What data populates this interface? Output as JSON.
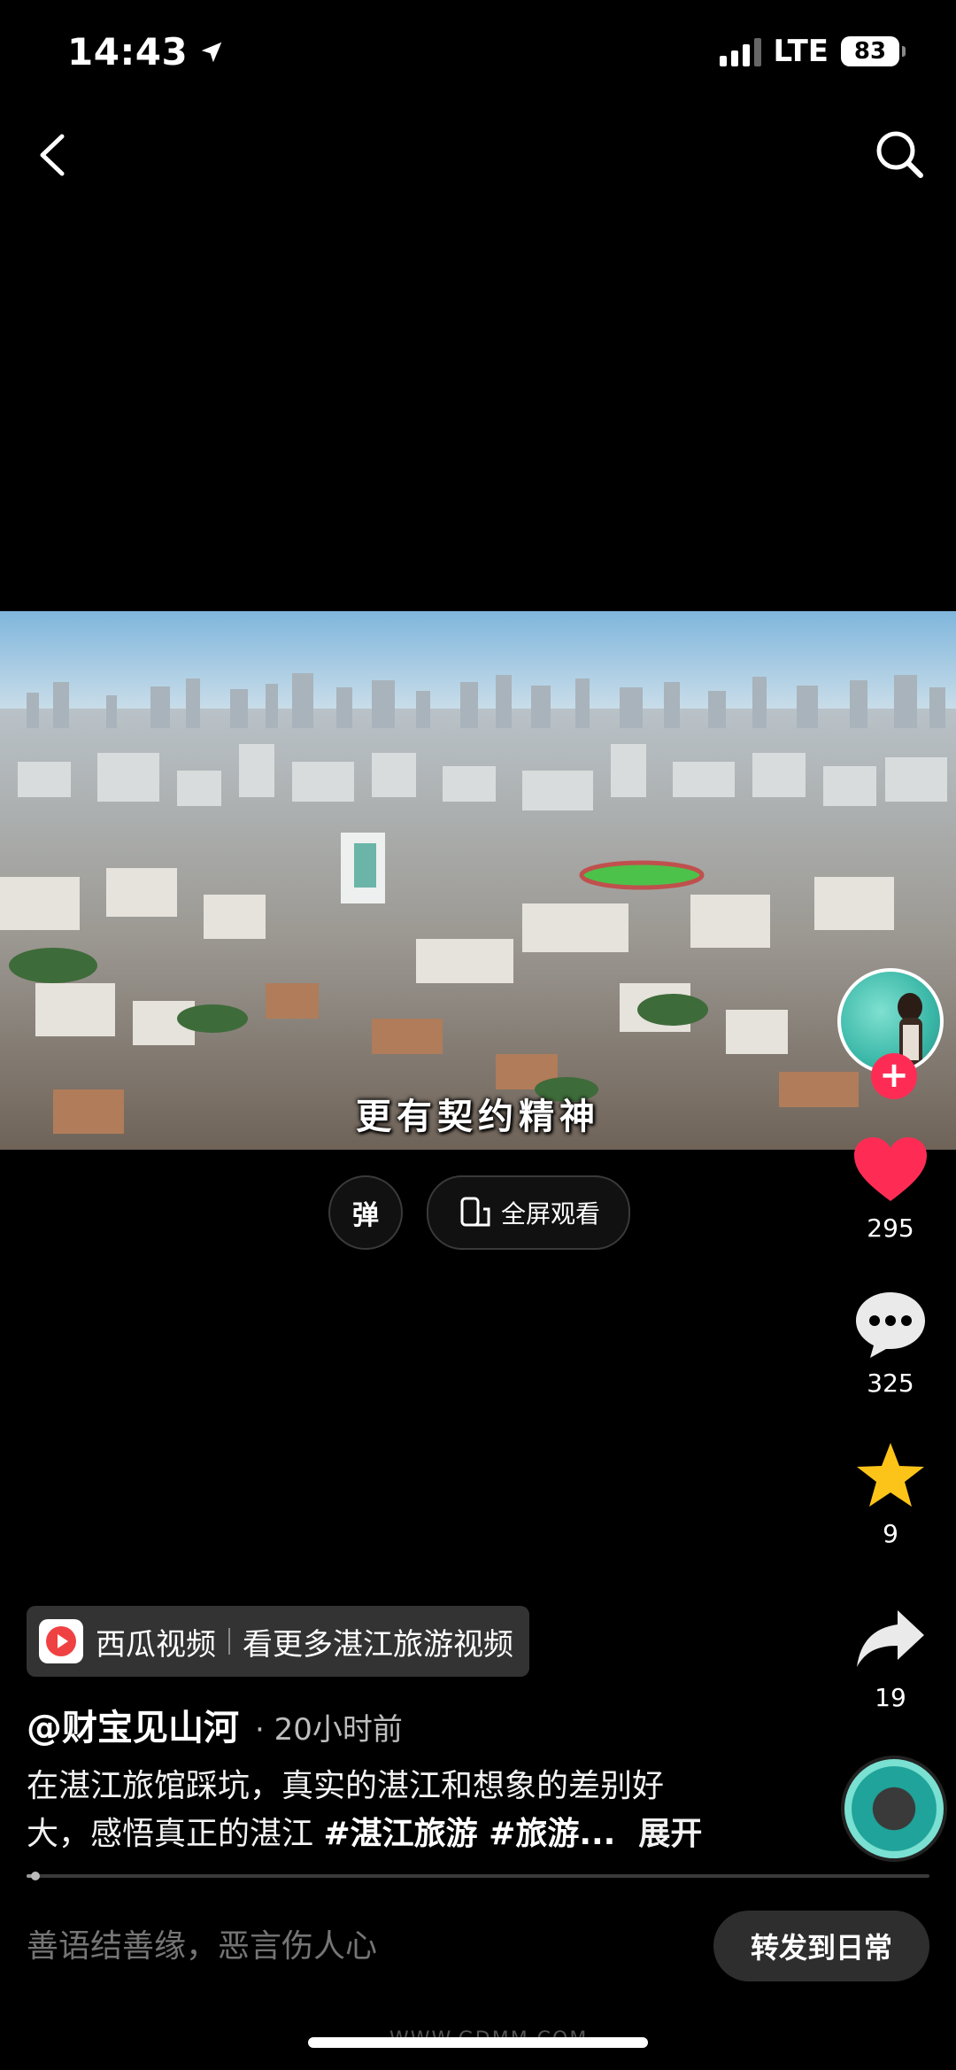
{
  "status_bar": {
    "time": "14:43",
    "network": "LTE",
    "battery": "83"
  },
  "video": {
    "subtitle": "更有契约精神"
  },
  "controls": {
    "danmu_label": "弹",
    "fullscreen_label": "全屏观看"
  },
  "actions": {
    "like_count": "295",
    "comment_count": "325",
    "favorite_count": "9",
    "share_count": "19",
    "follow_label": "+"
  },
  "xigua": {
    "brand": "西瓜视频",
    "link": "看更多湛江旅游视频"
  },
  "post": {
    "author": "@财宝见山河",
    "time": "· 20小时前",
    "desc_line1": "在湛江旅馆踩坑，真实的湛江和想象的差别好",
    "desc_line2": "大，感悟真正的湛江 ",
    "tags": "#湛江旅游 #旅游...",
    "expand": "展开"
  },
  "progress": {
    "fraction": 0.01
  },
  "comment_bar": {
    "placeholder": "善语结善缘，恶言伤人心",
    "share_daily": "转发到日常"
  },
  "watermark": "WWW.GDMM.COM",
  "colors": {
    "like": "#fe2c55",
    "favorite": "#fcc419",
    "background": "#000000"
  }
}
